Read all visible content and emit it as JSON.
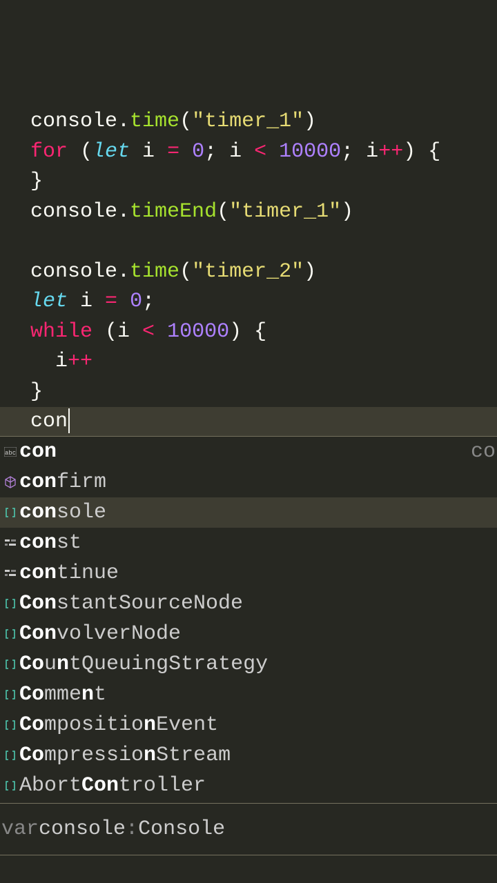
{
  "code": {
    "l1": "console",
    "l1m": "time",
    "l1s": "\"timer_1\"",
    "l2_for": "for",
    "l2_let": "let",
    "l2_a": " i ",
    "l2_eq": "=",
    "l2_sp": " ",
    "l2_zero": "0",
    "l2_semi": "; i ",
    "l2_lt": "<",
    "l2_num": "10000",
    "l2_semi2": "; i",
    "l2_pp": "++",
    "l2_close": ") {",
    "l3": "}",
    "l4": "console",
    "l4m": "timeEnd",
    "l4s": "\"timer_1\"",
    "l6": "console",
    "l6m": "time",
    "l6s": "\"timer_2\"",
    "l7_let": "let",
    "l7_rest": " i ",
    "l7_eq": "=",
    "l7_sp": " ",
    "l7_zero": "0",
    "l7_semi": ";",
    "l8_while": "while",
    "l8_open": " (i ",
    "l8_lt": "<",
    "l8_sp": " ",
    "l8_num": "10000",
    "l8_close": ") {",
    "l9_indent": "  i",
    "l9_pp": "++",
    "l10": "}",
    "l11": "con"
  },
  "autocomplete": {
    "typed": "con",
    "hint": "co",
    "items": [
      {
        "prefix": "con",
        "rest": "",
        "icon": "abc",
        "selected": false
      },
      {
        "prefix": "con",
        "rest": "firm",
        "icon": "cube",
        "selected": false
      },
      {
        "prefix": "con",
        "rest": "sole",
        "icon": "bracket",
        "selected": true
      },
      {
        "prefix": "con",
        "rest": "st",
        "icon": "keyword",
        "selected": false
      },
      {
        "prefix": "con",
        "rest": "tinue",
        "icon": "keyword",
        "selected": false
      },
      {
        "prefix": "Con",
        "rest": "stantSourceNode",
        "icon": "bracket",
        "selected": false
      },
      {
        "prefix": "Con",
        "rest": "volverNode",
        "icon": "bracket",
        "selected": false
      },
      {
        "prefix": "Co",
        "rest": "u",
        "mid": "n",
        "rest2": "tQueuingStrategy",
        "icon": "bracket",
        "selected": false
      },
      {
        "prefix": "Co",
        "rest": "mme",
        "mid": "n",
        "rest2": "t",
        "icon": "bracket",
        "selected": false
      },
      {
        "prefix": "Co",
        "rest": "mpositio",
        "mid": "n",
        "rest2": "Event",
        "icon": "bracket",
        "selected": false
      },
      {
        "prefix": "Co",
        "rest": "mpressio",
        "mid": "n",
        "rest2": "Stream",
        "icon": "bracket",
        "selected": false
      },
      {
        "prefix": "",
        "rest": "Abort",
        "mid": "Con",
        "rest2": "troller",
        "icon": "bracket",
        "selected": false
      }
    ]
  },
  "detail": {
    "cutoff": "var ",
    "name": "console",
    "colon": ": ",
    "type": "Console"
  }
}
